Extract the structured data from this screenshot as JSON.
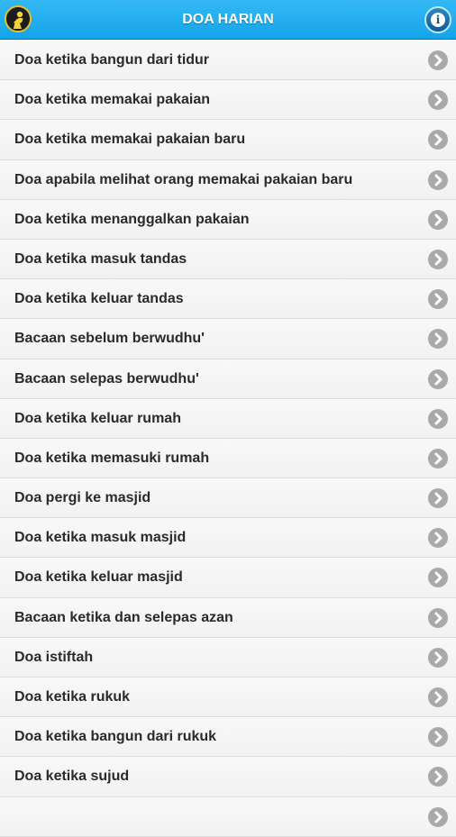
{
  "header": {
    "title": "DOA HARIAN",
    "logo_icon": "praying-man-logo",
    "info_icon": "info-icon",
    "info_glyph": "i",
    "accent_color": "#1aa6ec"
  },
  "list": {
    "chevron_icon": "chevron-right-icon",
    "items": [
      {
        "label": "Doa ketika bangun dari tidur"
      },
      {
        "label": "Doa ketika memakai pakaian"
      },
      {
        "label": "Doa ketika memakai pakaian baru"
      },
      {
        "label": "Doa apabila melihat orang memakai pakaian baru"
      },
      {
        "label": "Doa ketika menanggalkan pakaian"
      },
      {
        "label": "Doa ketika masuk tandas"
      },
      {
        "label": "Doa ketika keluar tandas"
      },
      {
        "label": "Bacaan sebelum berwudhu'"
      },
      {
        "label": "Bacaan selepas berwudhu'"
      },
      {
        "label": "Doa ketika keluar rumah"
      },
      {
        "label": "Doa ketika memasuki rumah"
      },
      {
        "label": "Doa pergi ke masjid"
      },
      {
        "label": "Doa ketika masuk masjid"
      },
      {
        "label": "Doa ketika keluar masjid"
      },
      {
        "label": "Bacaan ketika dan selepas azan"
      },
      {
        "label": "Doa istiftah"
      },
      {
        "label": "Doa ketika rukuk"
      },
      {
        "label": "Doa ketika bangun dari rukuk"
      },
      {
        "label": "Doa ketika sujud"
      },
      {
        "label": ""
      }
    ]
  }
}
